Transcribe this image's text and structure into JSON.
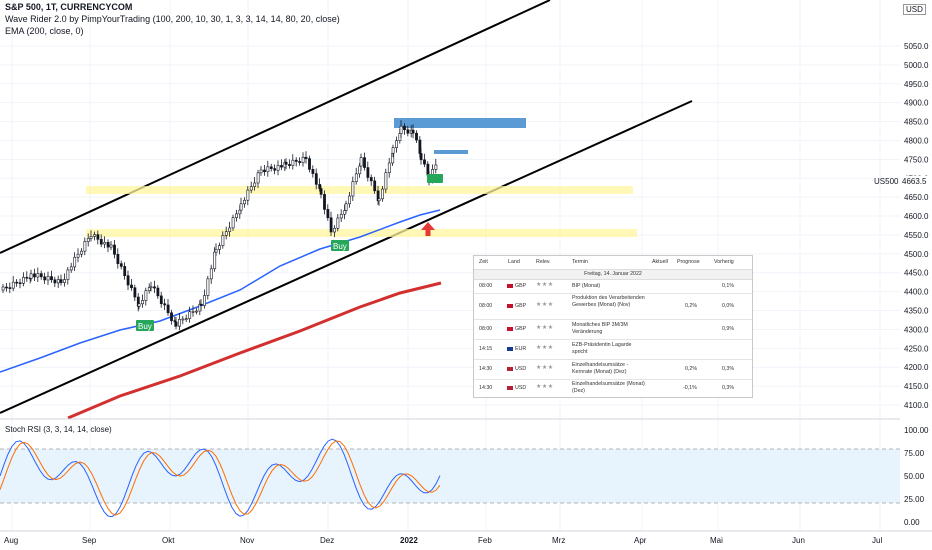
{
  "header": {
    "line1": "S&P 500, 1T, CURRENCYCOM",
    "line2": "Wave Rider 2.0 by PimpYourTrading (100, 200, 10, 30, 1, 3, 3, 14, 14, 80, 20, close)",
    "line3": "EMA (200, close, 0)"
  },
  "price_axis": {
    "currency": "USD",
    "ticks": [
      "5050.0",
      "5000.0",
      "4950.0",
      "4900.0",
      "4850.0",
      "4800.0",
      "4750.0",
      "4700.0",
      "4650.0",
      "4600.0",
      "4550.0",
      "4500.0",
      "4450.0",
      "4400.0",
      "4350.0",
      "4300.0",
      "4250.0",
      "4200.0",
      "4150.0",
      "4100.0"
    ],
    "last_price": "4663.5",
    "symbol": "US500"
  },
  "rsi_axis": {
    "ticks": [
      "100.00",
      "75.00",
      "50.00",
      "25.00",
      "0.00"
    ]
  },
  "time_axis": {
    "labels": [
      "Aug",
      "Sep",
      "Okt",
      "Nov",
      "Dez",
      "2022",
      "Feb",
      "Mrz",
      "Apr",
      "Mai",
      "Jun",
      "Jul"
    ]
  },
  "rsi_header": "Stoch RSI (3, 3, 14, 14, close)",
  "signals": {
    "buy": "Buy"
  },
  "calendar": {
    "headers": {
      "time": "Zeit",
      "country": "Land",
      "relevance": "Relev.",
      "event": "Termin",
      "actual": "Aktuell",
      "forecast": "Prognose",
      "previous": "Vorherig"
    },
    "day": "Freitag, 14. Januar 2022",
    "rows": [
      {
        "time": "08:00",
        "cur": "GBP",
        "event": "BIP (Monat)",
        "forecast": "",
        "previous": "0,1%"
      },
      {
        "time": "08:00",
        "cur": "GBP",
        "event": "Produktion des Verarbeitenden Gewerbes (Monat) (Nov)",
        "forecast": "0,2%",
        "previous": "0,0%"
      },
      {
        "time": "08:00",
        "cur": "GBP",
        "event": "Monatliches BIP 3M/3M Veränderung",
        "forecast": "",
        "previous": "0,9%"
      },
      {
        "time": "14:15",
        "cur": "EUR",
        "event": "EZB-Präsidentin Lagarde spricht",
        "forecast": "",
        "previous": ""
      },
      {
        "time": "14:30",
        "cur": "USD",
        "event": "Einzelhandelsumsätze - Kernrate (Monat) (Dez)",
        "forecast": "0,2%",
        "previous": "0,3%"
      },
      {
        "time": "14:30",
        "cur": "USD",
        "event": "Einzelhandelsumsätze (Monat) (Dez)",
        "forecast": "-0,1%",
        "previous": "0,3%"
      }
    ]
  },
  "colors": {
    "up": "#131722",
    "down": "#131722",
    "ema100": "#2962ff",
    "ema200": "#d32f2f",
    "zone": "#fff59d",
    "supply": "#5b9bd5",
    "rsi_k": "#2962ff",
    "rsi_d": "#ff6d00",
    "buy": "#26a65b"
  },
  "chart_data": {
    "type": "candlestick",
    "title": "S&P 500, 1T, CURRENCYCOM",
    "x": [
      "Aug",
      "Sep",
      "Okt",
      "Nov",
      "Dez",
      "2022"
    ],
    "ylim": [
      4075,
      5075
    ],
    "series": [
      {
        "name": "EMA (200, close, 0)",
        "values_approx": [
          4040,
          4150,
          4250,
          4330,
          4380,
          4410
        ]
      }
    ],
    "indicator": {
      "name": "Stoch RSI (3, 3, 14, 14, close)",
      "ylim": [
        0,
        100
      ],
      "bands": [
        20,
        80
      ]
    }
  }
}
